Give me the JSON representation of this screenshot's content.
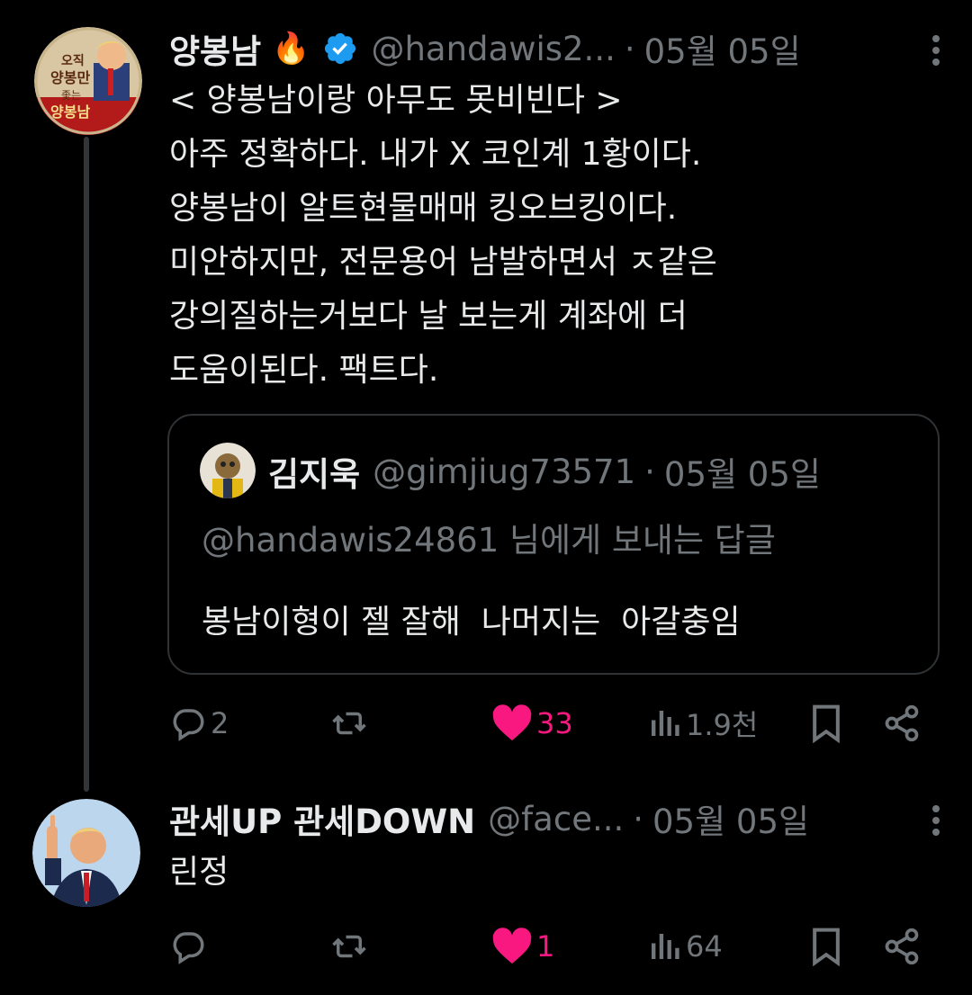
{
  "tweets": [
    {
      "name": "양봉남",
      "emoji": "🔥",
      "handle": "@handawis2...",
      "date": "05월 05일",
      "lines": [
        "< 양봉남이랑 아무도 못비빈다 >",
        "아주 정확하다. 내가 X 코인계 1황이다.",
        "양봉남이 알트현물매매 킹오브킹이다.",
        "미안하지만, 전문용어 남발하면서 ㅈ같은",
        "강의질하는거보다 날 보는게 계좌에 더",
        "도움이된다. 팩트다."
      ],
      "quote": {
        "name": "김지욱",
        "handle": "@gimjiug73571",
        "date": "05월 05일",
        "reply_to": "@handawis24861 님에게 보내는 답글",
        "text": "봉남이형이 젤 잘해  나머지는  아갈충임"
      },
      "stats": {
        "replies": "2",
        "reposts": "",
        "likes": "33",
        "views": "1.9천"
      }
    },
    {
      "name": "관세UP 관세DOWN",
      "handle": "@face...",
      "date": "05월 05일",
      "lines": [
        "린정"
      ],
      "stats": {
        "replies": "",
        "reposts": "",
        "likes": "1",
        "views": "64"
      }
    }
  ],
  "separator": "·",
  "colors": {
    "background": "#000000",
    "text": "#e7e9ea",
    "muted": "#71767b",
    "like": "#f91880",
    "verified": "#1d9bf0",
    "border": "#2f3336"
  },
  "icons": [
    "reply-icon",
    "repost-icon",
    "heart-icon",
    "views-icon",
    "bookmark-icon",
    "share-icon",
    "more-icon",
    "verified-badge-icon",
    "fire-emoji"
  ]
}
